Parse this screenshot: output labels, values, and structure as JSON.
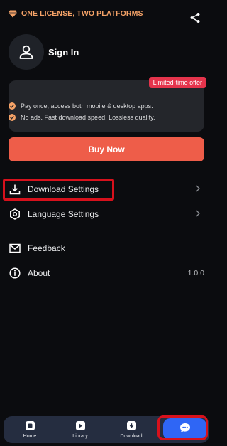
{
  "header": {
    "share_icon": "share-icon"
  },
  "profile": {
    "avatar_icon": "user-icon",
    "sign_in_label": "Sign In"
  },
  "promo": {
    "badge": "Limited-time offer",
    "title": "ONE LICENSE, TWO PLATFORMS",
    "items": [
      "Pay once, access both mobile & desktop apps.",
      "No ads. Fast download speed. Lossless quality."
    ],
    "buy_label": "Buy Now",
    "accent_color": "#f4a267",
    "button_color": "#ee5d49"
  },
  "menu": {
    "download_settings": "Download Settings",
    "language_settings": "Language Settings",
    "feedback": "Feedback",
    "about": "About",
    "about_value": "1.0.0"
  },
  "nav": {
    "home": "Home",
    "library": "Library",
    "download": "Download",
    "active_color": "#2f66f5"
  },
  "highlight_color": "#d7111c"
}
